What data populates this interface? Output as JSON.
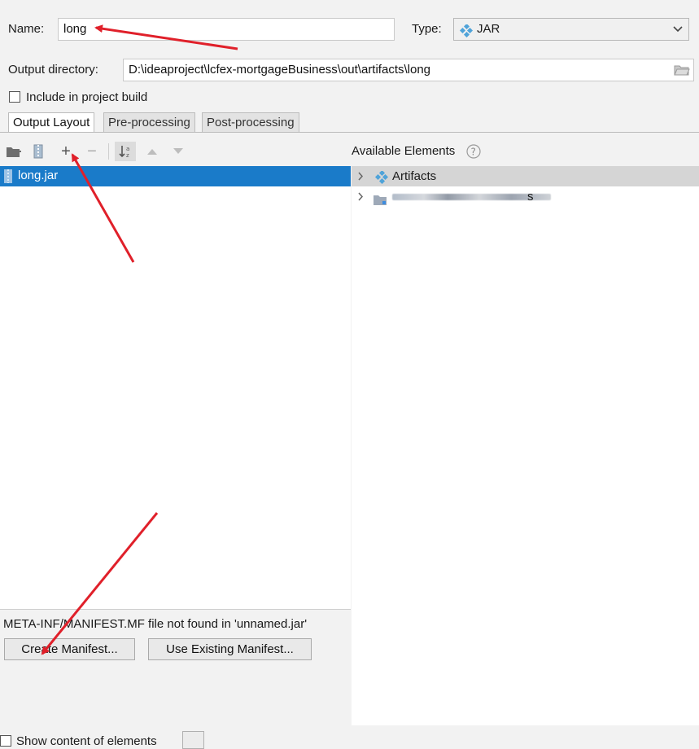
{
  "form": {
    "name_label": "Name:",
    "name_value": "long",
    "type_label": "Type:",
    "type_value": "JAR",
    "output_dir_label": "Output directory:",
    "output_dir_value": "D:\\ideaproject\\lcfex-mortgageBusiness\\out\\artifacts\\long",
    "include_label": "Include in project build",
    "include_checked": false
  },
  "tabs": [
    {
      "label": "Output Layout",
      "active": true
    },
    {
      "label": "Pre-processing",
      "active": false
    },
    {
      "label": "Post-processing",
      "active": false
    }
  ],
  "toolbar": {
    "icons": [
      "new-folder-icon",
      "archive-icon",
      "add-icon",
      "remove-icon",
      "sort-icon",
      "move-up-icon",
      "move-down-icon"
    ]
  },
  "layout_tree": {
    "items": [
      {
        "label": "long.jar",
        "selected": true
      }
    ]
  },
  "available": {
    "title": "Available Elements",
    "help_icon": "help-icon",
    "items": [
      {
        "label": "Artifacts",
        "highlighted": true
      },
      {
        "label": "s",
        "blurred": true
      }
    ]
  },
  "manifest": {
    "message": "META-INF/MANIFEST.MF file not found in 'unnamed.jar'",
    "create_label": "Create Manifest...",
    "use_existing_label": "Use Existing Manifest..."
  },
  "footer": {
    "show_content_label": "Show content of elements"
  },
  "colors": {
    "selection": "#1a7bc9",
    "annotation_arrow": "#e0202a",
    "jar_icon": "#4fa3d9"
  }
}
